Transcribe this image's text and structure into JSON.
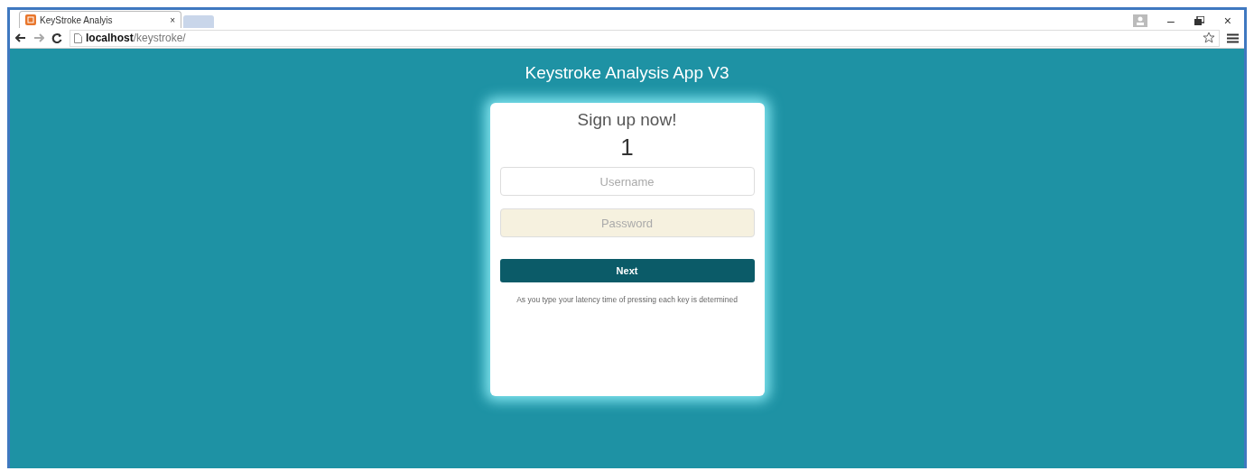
{
  "browser": {
    "tab": {
      "title": "KeyStroke Analyis",
      "close": "×",
      "selected": true
    },
    "address": {
      "host": "localhost",
      "path": "/keystroke/"
    },
    "window_controls": [
      "–",
      "×"
    ]
  },
  "page": {
    "title": "Keystroke Analysis App V3"
  },
  "card": {
    "heading": "Sign up now!",
    "step": "1",
    "fields": [
      {
        "placeholder": "Username",
        "autofilled": false
      },
      {
        "placeholder": "Password",
        "autofilled": true
      }
    ],
    "button": "Next",
    "note": "As you type your latency time of pressing each key is determined"
  }
}
